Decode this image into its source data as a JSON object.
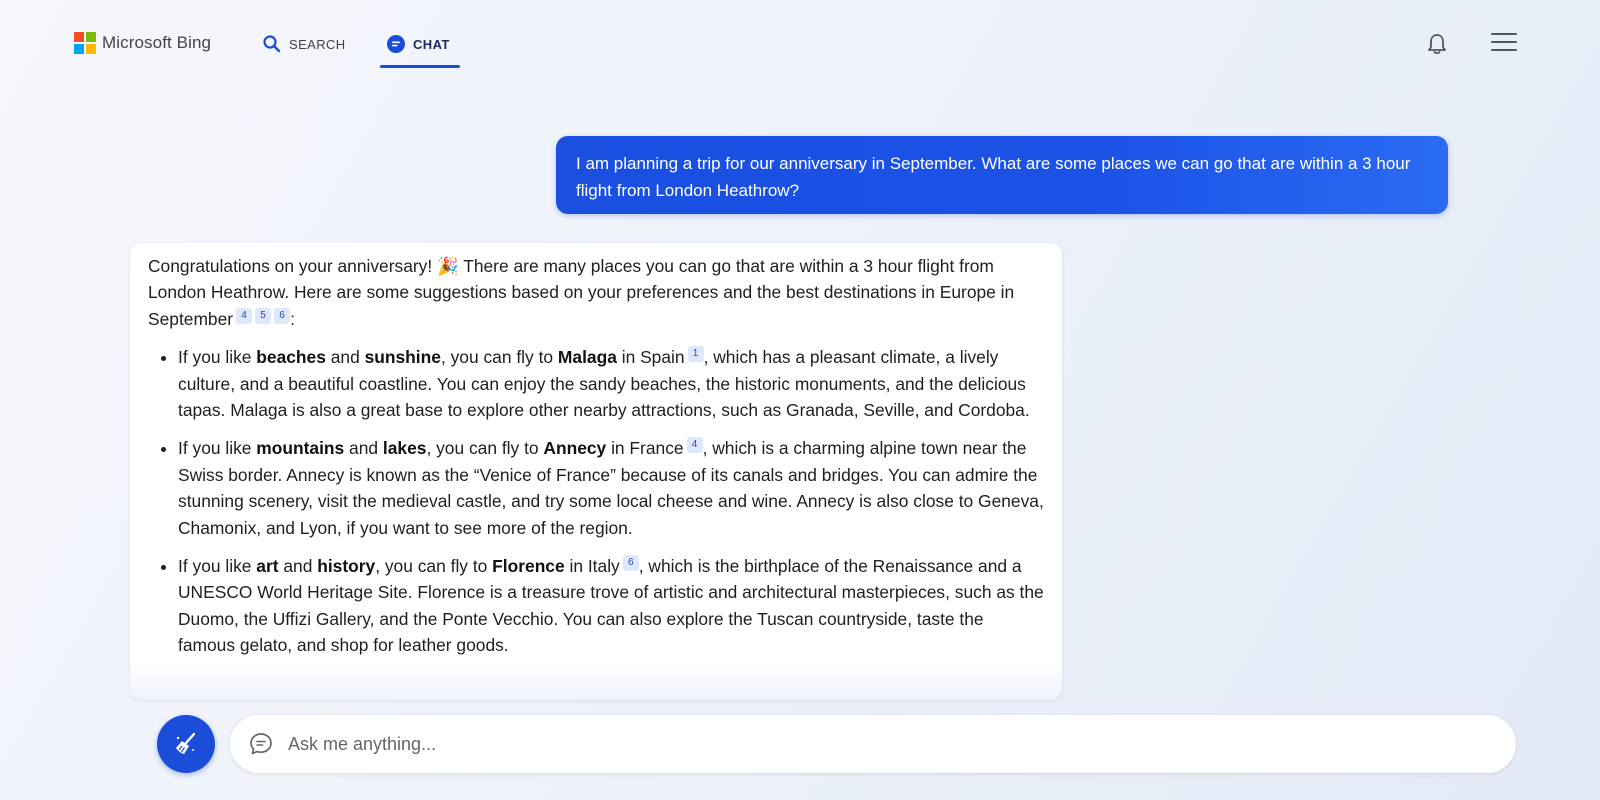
{
  "header": {
    "brand": "Microsoft Bing",
    "brand_colors": [
      "#f25022",
      "#7fba00",
      "#00a4ef",
      "#ffb900"
    ],
    "tabs": [
      {
        "label": "SEARCH",
        "icon": "search-icon",
        "active": false
      },
      {
        "label": "CHAT",
        "icon": "chat-bubble-icon",
        "active": true
      }
    ],
    "right_icons": [
      "bell-icon",
      "hamburger-menu-icon"
    ]
  },
  "conversation": {
    "user_message": "I am planning a trip for our anniversary in September. What are some places we can go that are within a 3 hour flight from London Heathrow?",
    "bot": {
      "intro_a": "Congratulations on your anniversary! ",
      "intro_emoji": "🎉",
      "intro_b": " There are many places you can go that are within a 3 hour flight from London Heathrow. Here are some suggestions based on your preferences and the best destinations in Europe in September",
      "intro_citations": [
        "4",
        "5",
        "6"
      ],
      "intro_end": ":",
      "items": [
        {
          "t1": "If you like ",
          "k1": "beaches",
          "t2": " and ",
          "k2": "sunshine",
          "t3": ", you can fly to ",
          "place": "Malaga",
          "t4": " in Spain",
          "citation": "1",
          "rest": ", which has a pleasant climate, a lively culture, and a beautiful coastline. You can enjoy the sandy beaches, the historic monuments, and the delicious tapas. Malaga is also a great base to explore other nearby attractions, such as Granada, Seville, and Cordoba."
        },
        {
          "t1": "If you like ",
          "k1": "mountains",
          "t2": " and ",
          "k2": "lakes",
          "t3": ", you can fly to ",
          "place": "Annecy",
          "t4": " in France",
          "citation": "4",
          "rest": ", which is a charming alpine town near the Swiss border. Annecy is known as the “Venice of France” because of its canals and bridges. You can admire the stunning scenery, visit the medieval castle, and try some local cheese and wine. Annecy is also close to Geneva, Chamonix, and Lyon, if you want to see more of the region."
        },
        {
          "t1": "If you like ",
          "k1": "art",
          "t2": " and ",
          "k2": "history",
          "t3": ", you can fly to ",
          "place": "Florence",
          "t4": " in Italy",
          "citation": "6",
          "rest": ", which is the birthplace of the Renaissance and a UNESCO World Heritage Site. Florence is a treasure trove of artistic and architectural masterpieces, such as the Duomo, the Uffizi Gallery, and the Ponte Vecchio. You can also explore the Tuscan countryside, taste the famous gelato, and shop for leather goods."
        }
      ]
    }
  },
  "composer": {
    "placeholder": "Ask me anything...",
    "new_topic_icon": "broom-icon",
    "input_icon": "chat-outline-icon",
    "accent": "#1b4dd8"
  }
}
